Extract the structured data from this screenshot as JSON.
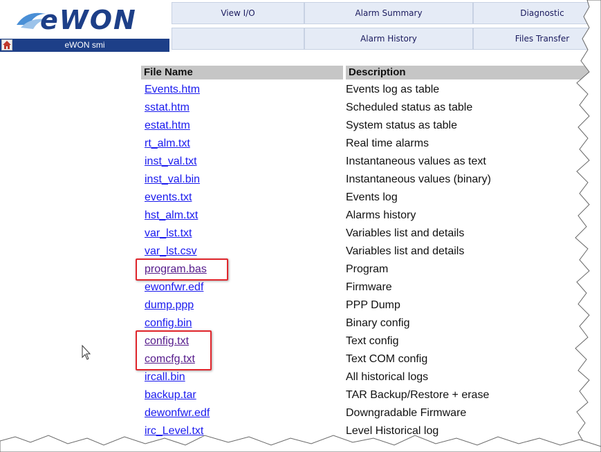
{
  "header": {
    "logo_text": "eWON",
    "device_name": "eWON smi",
    "nav_row1": [
      "View I/O",
      "Alarm Summary",
      "Diagnostic"
    ],
    "nav_row2": [
      "",
      "Alarm History",
      "Files Transfer"
    ]
  },
  "table": {
    "headers": {
      "file_name": "File Name",
      "description": "Description"
    },
    "rows": [
      {
        "file": "Events.htm",
        "desc": "Events log as table"
      },
      {
        "file": "sstat.htm",
        "desc": "Scheduled status as table"
      },
      {
        "file": "estat.htm",
        "desc": "System status as table"
      },
      {
        "file": "rt_alm.txt",
        "desc": "Real time alarms"
      },
      {
        "file": "inst_val.txt",
        "desc": "Instantaneous values as text"
      },
      {
        "file": "inst_val.bin",
        "desc": "Instantaneous values (binary)"
      },
      {
        "file": "events.txt",
        "desc": "Events log"
      },
      {
        "file": "hst_alm.txt",
        "desc": "Alarms history"
      },
      {
        "file": "var_lst.txt",
        "desc": "Variables list and details"
      },
      {
        "file": "var_lst.csv",
        "desc": "Variables list and details"
      },
      {
        "file": "program.bas",
        "desc": "Program"
      },
      {
        "file": "ewonfwr.edf",
        "desc": "Firmware"
      },
      {
        "file": "dump.ppp",
        "desc": "PPP Dump"
      },
      {
        "file": "config.bin",
        "desc": "Binary config"
      },
      {
        "file": "config.txt",
        "desc": "Text config"
      },
      {
        "file": "comcfg.txt",
        "desc": "Text COM config"
      },
      {
        "file": "ircall.bin",
        "desc": "All historical logs"
      },
      {
        "file": "backup.tar",
        "desc": "TAR Backup/Restore + erase"
      },
      {
        "file": "dewonfwr.edf",
        "desc": "Downgradable Firmware"
      },
      {
        "file": "irc_Level.txt",
        "desc": "Level Historical log"
      }
    ]
  },
  "colors": {
    "brand": "#1d3f88",
    "link": "#1a1aee",
    "visited_link": "#551a8b",
    "highlight": "#e0262c",
    "header_bg": "#c6c6c6"
  },
  "icons": [
    "home-icon",
    "mouse-cursor-icon"
  ]
}
